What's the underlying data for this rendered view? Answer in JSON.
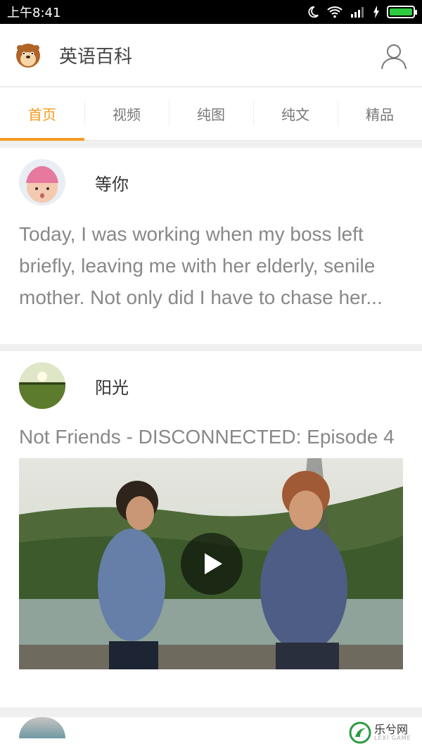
{
  "status_bar": {
    "time": "上午8:41"
  },
  "header": {
    "title": "英语百科"
  },
  "tabs": [
    {
      "label": "首页",
      "active": true
    },
    {
      "label": "视频"
    },
    {
      "label": "纯图"
    },
    {
      "label": "纯文"
    },
    {
      "label": "精品"
    }
  ],
  "posts": [
    {
      "username": "等你",
      "text": "Today, I was working when my boss left briefly, leaving me with her elderly, senile mother. Not only did I have to chase her..."
    },
    {
      "username": "阳光",
      "video_title": "Not Friends - DISCONNECTED: Episode 4"
    }
  ],
  "watermark": {
    "text": "乐兮网",
    "sub": "LEXI GAME"
  },
  "colors": {
    "accent": "#f39a1e",
    "text_gray": "#888888"
  }
}
